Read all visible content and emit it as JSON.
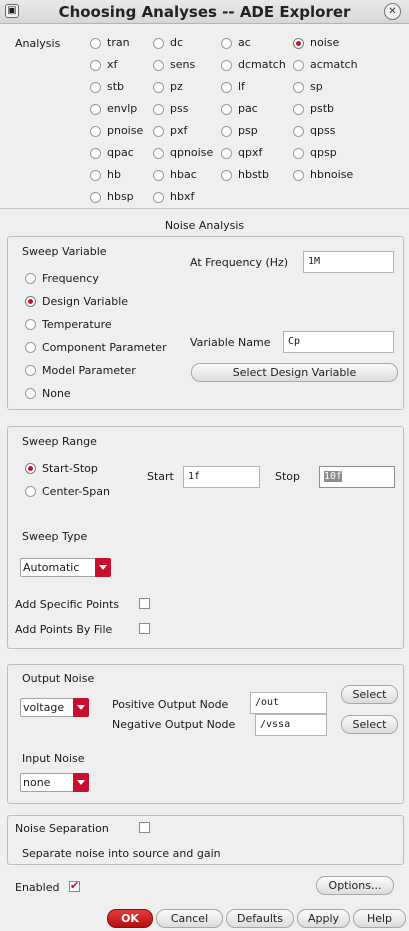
{
  "window": {
    "title": "Choosing Analyses -- ADE Explorer",
    "icon": "app-icon",
    "close": "close-icon"
  },
  "analysis": {
    "label": "Analysis",
    "selected": "noise",
    "options": [
      "tran",
      "dc",
      "ac",
      "noise",
      "xf",
      "sens",
      "dcmatch",
      "acmatch",
      "stb",
      "pz",
      "lf",
      "sp",
      "envlp",
      "pss",
      "pac",
      "pstb",
      "pnoise",
      "pxf",
      "psp",
      "qpss",
      "qpac",
      "qpnoise",
      "qpxf",
      "qpsp",
      "hb",
      "hbac",
      "hbstb",
      "hbnoise",
      "hbsp",
      "hbxf"
    ]
  },
  "section_title": "Noise Analysis",
  "sweep_variable": {
    "label": "Sweep Variable",
    "options": [
      "Frequency",
      "Design Variable",
      "Temperature",
      "Component Parameter",
      "Model Parameter",
      "None"
    ],
    "selected": "Design Variable",
    "at_frequency_label": "At Frequency (Hz)",
    "at_frequency_value": "1M",
    "variable_name_label": "Variable Name",
    "variable_name_value": "Cp",
    "select_design_variable": "Select Design Variable"
  },
  "sweep_range": {
    "label": "Sweep Range",
    "options": [
      "Start-Stop",
      "Center-Span"
    ],
    "selected": "Start-Stop",
    "start_label": "Start",
    "start_value": "1f",
    "stop_label": "Stop",
    "stop_value": "10f",
    "sweep_type_label": "Sweep Type",
    "sweep_type_value": "Automatic",
    "add_specific_points": "Add Specific Points",
    "add_points_by_file": "Add Points By File"
  },
  "output_noise": {
    "label": "Output Noise",
    "type_value": "voltage",
    "positive_label": "Positive Output Node",
    "positive_value": "/out",
    "negative_label": "Negative Output Node",
    "negative_value": "/vssa",
    "select_label": "Select",
    "input_noise_label": "Input Noise",
    "input_noise_value": "none"
  },
  "noise_separation": {
    "label": "Noise Separation",
    "desc": "Separate noise into source and gain"
  },
  "enabled": {
    "label": "Enabled",
    "checked": true
  },
  "buttons": {
    "options": "Options...",
    "ok": "OK",
    "cancel": "Cancel",
    "defaults": "Defaults",
    "apply": "Apply",
    "help": "Help"
  },
  "colors": {
    "accent": "#c8102e",
    "background": "#efefef"
  }
}
